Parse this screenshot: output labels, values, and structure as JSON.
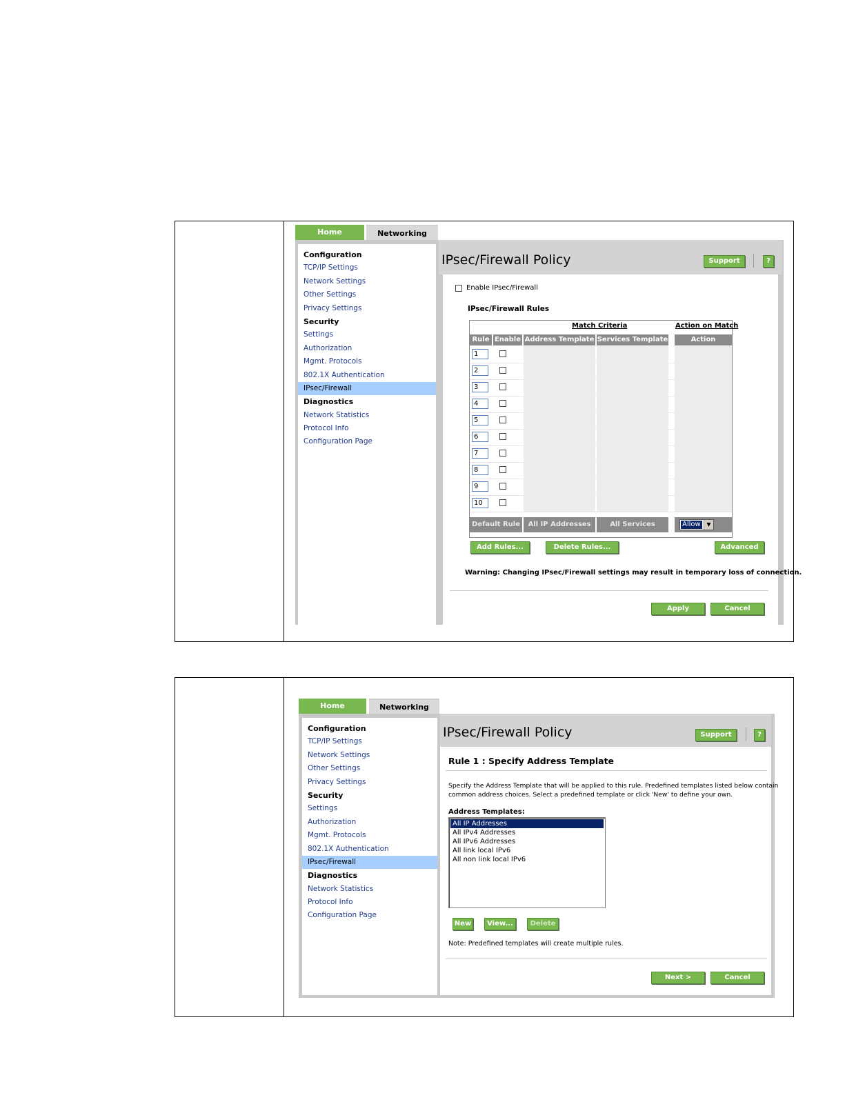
{
  "tabs": {
    "home": "Home",
    "networking": "Networking"
  },
  "nav": [
    {
      "label": "Configuration",
      "type": "head"
    },
    {
      "label": "TCP/IP Settings",
      "type": "link"
    },
    {
      "label": "Network Settings",
      "type": "link"
    },
    {
      "label": "Other Settings",
      "type": "link"
    },
    {
      "label": "Privacy Settings",
      "type": "link"
    },
    {
      "label": "Security",
      "type": "head"
    },
    {
      "label": "Settings",
      "type": "link"
    },
    {
      "label": "Authorization",
      "type": "link"
    },
    {
      "label": "Mgmt. Protocols",
      "type": "link"
    },
    {
      "label": "802.1X Authentication",
      "type": "link"
    },
    {
      "label": "IPsec/Firewall",
      "type": "active"
    },
    {
      "label": "Diagnostics",
      "type": "head"
    },
    {
      "label": "Network Statistics",
      "type": "link"
    },
    {
      "label": "Protocol Info",
      "type": "link"
    },
    {
      "label": "Configuration Page",
      "type": "link"
    }
  ],
  "page_title": "IPsec/Firewall Policy",
  "support_label": "Support",
  "help_label": "?",
  "screen1": {
    "enable_label": "Enable IPsec/Firewall",
    "rules_heading": "IPsec/Firewall Rules",
    "match_criteria": "Match Criteria",
    "action_on_match": "Action on Match",
    "headers": {
      "rule": "Rule",
      "enable": "Enable",
      "address": "Address Template",
      "services": "Services Template",
      "action": "Action"
    },
    "rules": [
      "1",
      "2",
      "3",
      "4",
      "5",
      "6",
      "7",
      "8",
      "9",
      "10"
    ],
    "default_row": {
      "rule": "Default Rule",
      "address": "All IP Addresses",
      "services": "All Services",
      "action": "Allow"
    },
    "add_rules": "Add Rules...",
    "delete_rules": "Delete Rules...",
    "advanced": "Advanced",
    "warning": "Warning: Changing IPsec/Firewall settings may result in temporary loss of connection.",
    "apply": "Apply",
    "cancel": "Cancel"
  },
  "screen2": {
    "heading": "Rule 1 : Specify Address Template",
    "description_1": "Specify the Address Template that will be applied to this rule. Predefined templates listed below contain",
    "description_2": "common address choices. Select a predefined template or click 'New' to define your own.",
    "list_label": "Address Templates:",
    "templates": [
      "All IP Addresses",
      "All IPv4 Addresses",
      "All IPv6 Addresses",
      "All link local IPv6",
      "All non link local IPv6"
    ],
    "new": "New",
    "view": "View...",
    "delete": "Delete",
    "note": "Note: Predefined templates will create multiple rules.",
    "next": "Next >",
    "cancel": "Cancel"
  }
}
